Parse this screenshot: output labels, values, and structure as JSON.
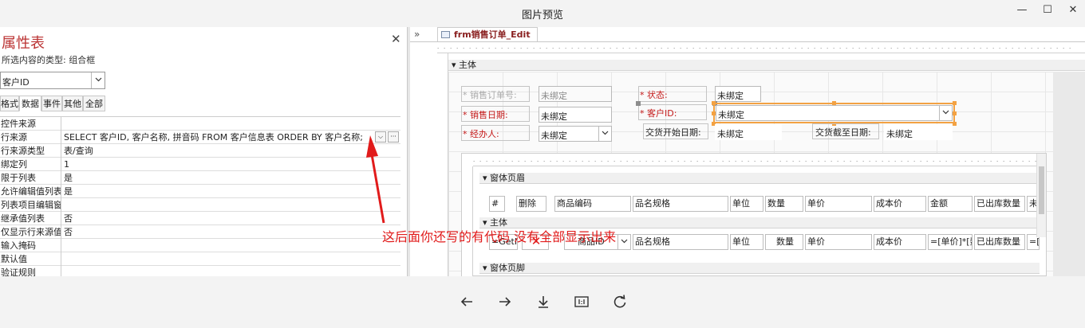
{
  "window": {
    "title": "图片预览",
    "minimize": "—",
    "maximize": "☐",
    "close": "✕"
  },
  "property_sheet": {
    "title": "属性表",
    "close": "✕",
    "subtitle": "所选内容的类型: 组合框",
    "selector_value": "客户ID",
    "tabs": [
      "格式",
      "数据",
      "事件",
      "其他",
      "全部"
    ],
    "active_tab": "数据",
    "rows": [
      {
        "key": "控件来源",
        "value": ""
      },
      {
        "key": "行来源",
        "value": "SELECT 客户ID, 客户名称, 拼音码 FROM 客户信息表 ORDER BY 客户名称;"
      },
      {
        "key": "行来源类型",
        "value": "表/查询"
      },
      {
        "key": "绑定列",
        "value": "1"
      },
      {
        "key": "限于列表",
        "value": "是"
      },
      {
        "key": "允许编辑值列表",
        "value": "是"
      },
      {
        "key": "列表项目编辑窗",
        "value": ""
      },
      {
        "key": "继承值列表",
        "value": "否"
      },
      {
        "key": "仅显示行来源值",
        "value": "否"
      },
      {
        "key": "输入掩码",
        "value": ""
      },
      {
        "key": "默认值",
        "value": ""
      },
      {
        "key": "验证规则",
        "value": ""
      }
    ]
  },
  "design": {
    "collapse": "»",
    "tab_label": "frm销售订单_Edit",
    "section_main": "主体",
    "labels": {
      "order_no": "* 销售订单号:",
      "status": "* 状态:",
      "sale_date": "* 销售日期:",
      "customer_id": "* 客户ID:",
      "handler": "* 经办人:",
      "start_date": "交货开始日期:",
      "end_date": "交货截至日期:"
    },
    "unbound": "未绑定",
    "sub_section_header": "窗体页眉",
    "sub_section_body": "主体",
    "sub_section_footer": "窗体页脚",
    "headers": [
      "#",
      "删除",
      "商品编码",
      "品名规格",
      "单位",
      "数量",
      "单价",
      "成本价",
      "金额",
      "已出库数量",
      "未出"
    ],
    "cells": [
      "=GetI",
      "✕",
      "商品ID",
      "品名规格",
      "单位",
      "数量",
      "单价",
      "成本价",
      "=[单价]*[数",
      "已出库数量",
      "=["
    ]
  },
  "annotation": "这后面你还写的有代码 没有全部显示出来",
  "colors": {
    "annotation_red": "#e11b1b",
    "label_red": "#c41818",
    "selection_orange": "#f3a243"
  }
}
